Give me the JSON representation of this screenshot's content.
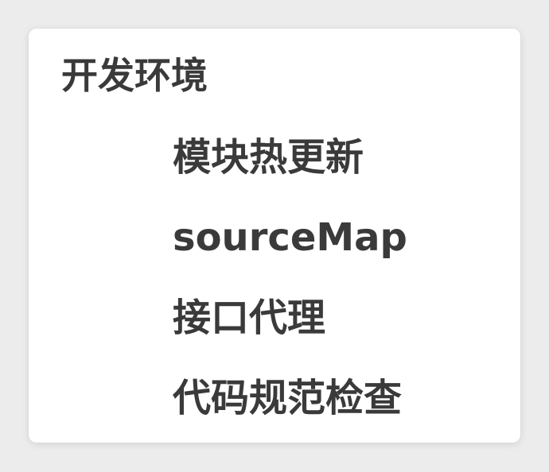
{
  "document": {
    "heading": "开发环境",
    "items": [
      "模块热更新",
      "sourceMap",
      "接口代理",
      "代码规范检查"
    ]
  }
}
